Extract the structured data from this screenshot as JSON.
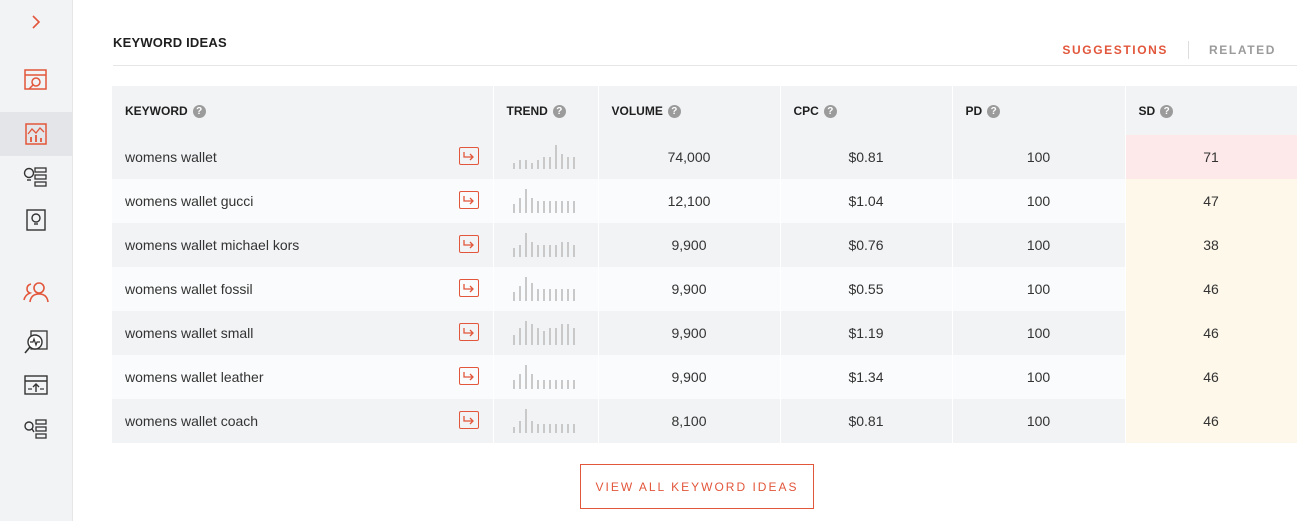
{
  "sidebar": {
    "expand": "expand-chevron-icon",
    "items": [
      "site-overview-icon",
      "keyword-overview-icon",
      "keyword-ideas-icon",
      "content-ideas-icon",
      "competitors-icon",
      "site-audit-icon",
      "rank-tracking-icon",
      "keyword-list-icon"
    ],
    "active_index": 1
  },
  "header": {
    "title": "KEYWORD IDEAS",
    "tabs": [
      {
        "label": "SUGGESTIONS",
        "active": true
      },
      {
        "label": "RELATED",
        "active": false
      }
    ]
  },
  "table": {
    "columns": [
      "KEYWORD",
      "TREND",
      "VOLUME",
      "CPC",
      "PD",
      "SD"
    ],
    "help_glyph": "?",
    "rows": [
      {
        "keyword": "womens wallet",
        "volume": "74,000",
        "cpc": "$0.81",
        "pd": "100",
        "sd": "71",
        "trend": [
          2,
          3,
          3,
          2,
          3,
          4,
          4,
          8,
          5,
          4,
          4
        ]
      },
      {
        "keyword": "womens wallet gucci",
        "volume": "12,100",
        "cpc": "$1.04",
        "pd": "100",
        "sd": "47",
        "trend": [
          3,
          5,
          8,
          5,
          4,
          4,
          4,
          4,
          4,
          4,
          4
        ]
      },
      {
        "keyword": "womens wallet michael kors",
        "volume": "9,900",
        "cpc": "$0.76",
        "pd": "100",
        "sd": "38",
        "trend": [
          3,
          4,
          8,
          5,
          4,
          4,
          4,
          4,
          5,
          5,
          4
        ]
      },
      {
        "keyword": "womens wallet fossil",
        "volume": "9,900",
        "cpc": "$0.55",
        "pd": "100",
        "sd": "46",
        "trend": [
          3,
          5,
          8,
          6,
          4,
          4,
          4,
          4,
          4,
          4,
          4
        ]
      },
      {
        "keyword": "womens wallet small",
        "volume": "9,900",
        "cpc": "$1.19",
        "pd": "100",
        "sd": "46",
        "trend": [
          3,
          5,
          7,
          6,
          5,
          4,
          5,
          5,
          6,
          6,
          5
        ]
      },
      {
        "keyword": "womens wallet leather",
        "volume": "9,900",
        "cpc": "$1.34",
        "pd": "100",
        "sd": "46",
        "trend": [
          3,
          5,
          8,
          5,
          3,
          3,
          3,
          3,
          3,
          3,
          3
        ]
      },
      {
        "keyword": "womens wallet coach",
        "volume": "8,100",
        "cpc": "$0.81",
        "pd": "100",
        "sd": "46",
        "trend": [
          2,
          4,
          8,
          4,
          3,
          3,
          3,
          3,
          3,
          3,
          3
        ]
      }
    ]
  },
  "footer": {
    "view_all_label": "VIEW ALL KEYWORD IDEAS"
  },
  "colors": {
    "accent": "#e2563b",
    "sd_high": "#fde9ea",
    "sd_medium": "#fef8ea",
    "trend_bar": "#c9c9c9"
  }
}
